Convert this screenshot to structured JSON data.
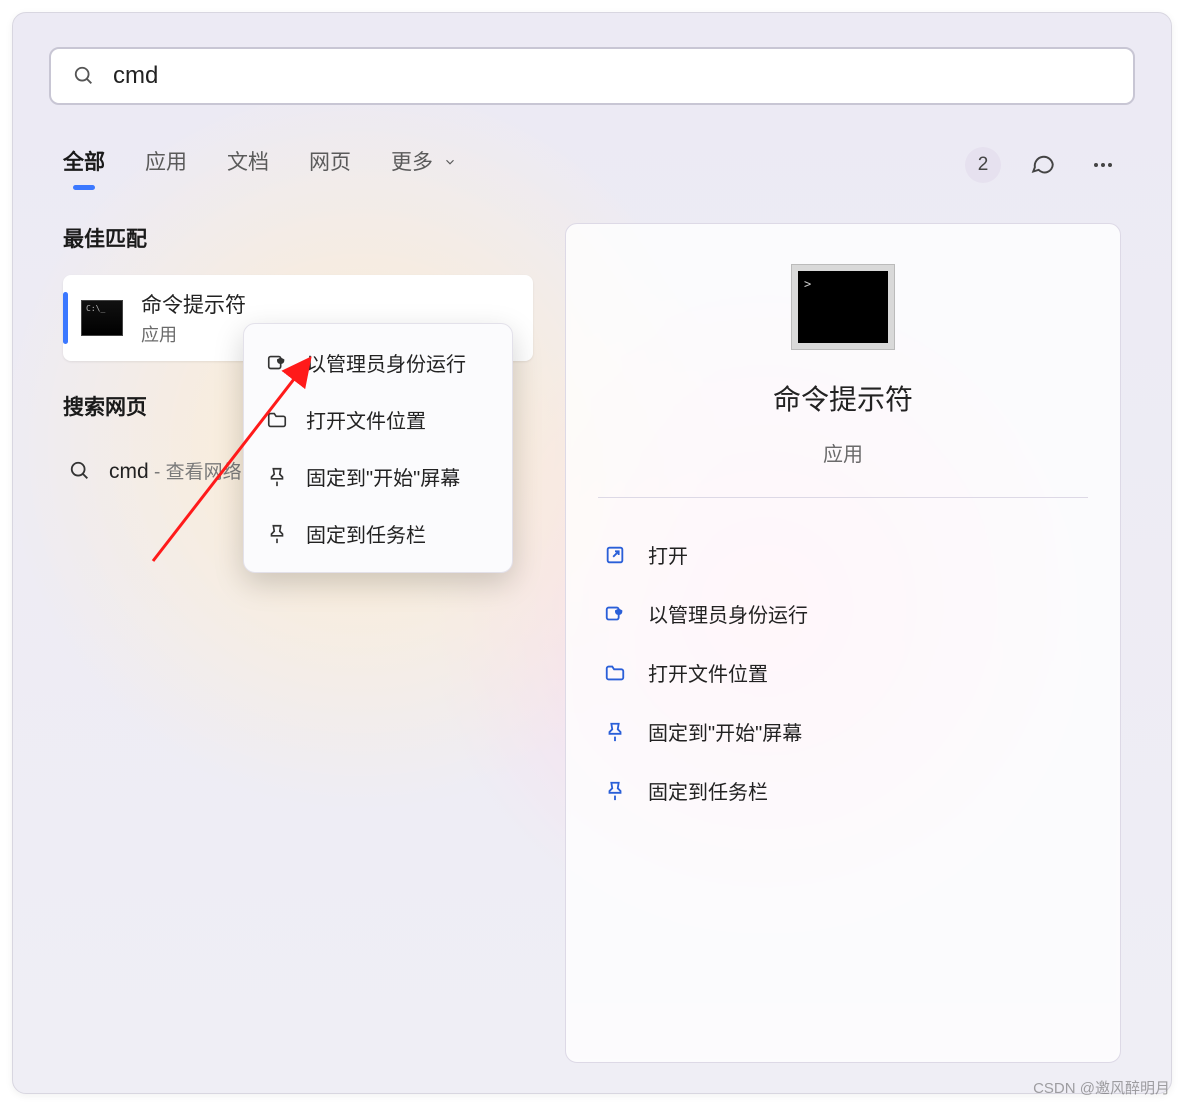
{
  "search": {
    "query": "cmd"
  },
  "tabs": {
    "items": [
      "全部",
      "应用",
      "文档",
      "网页",
      "更多"
    ],
    "active_index": 0,
    "badge_count": "2"
  },
  "sections": {
    "best_match_title": "最佳匹配",
    "search_web_title": "搜索网页"
  },
  "best_match": {
    "title": "命令提示符",
    "subtitle": "应用"
  },
  "web_result": {
    "prefix": "cmd",
    "suffix": " - 查看网络"
  },
  "context_menu": {
    "items": [
      {
        "icon": "shield-icon",
        "label": "以管理员身份运行"
      },
      {
        "icon": "folder-icon",
        "label": "打开文件位置"
      },
      {
        "icon": "pin-icon",
        "label": "固定到\"开始\"屏幕"
      },
      {
        "icon": "pin-icon",
        "label": "固定到任务栏"
      }
    ]
  },
  "detail_panel": {
    "title": "命令提示符",
    "subtitle": "应用",
    "actions": [
      {
        "icon": "open-icon",
        "label": "打开"
      },
      {
        "icon": "shield-icon",
        "label": "以管理员身份运行"
      },
      {
        "icon": "folder-icon",
        "label": "打开文件位置"
      },
      {
        "icon": "pin-icon",
        "label": "固定到\"开始\"屏幕"
      },
      {
        "icon": "pin-icon",
        "label": "固定到任务栏"
      }
    ]
  },
  "watermark": "CSDN @邀风醉明月"
}
